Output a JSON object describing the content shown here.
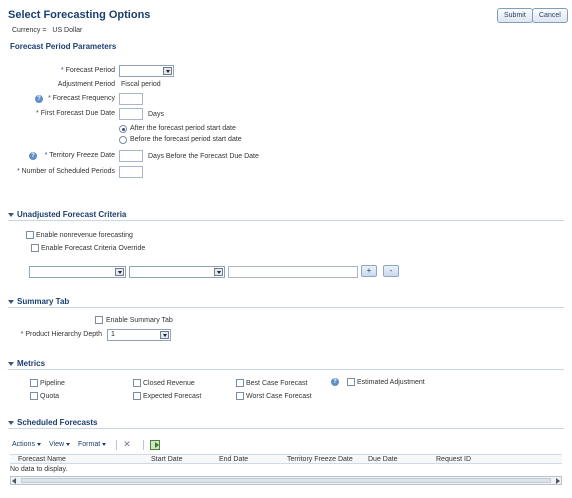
{
  "page": {
    "title": "Select Forecasting Options",
    "currency_label": "Currency =",
    "currency_value": "US Dollar",
    "submit_label": "Submit",
    "cancel_label": "Cancel"
  },
  "forecast_period_parameters": {
    "title": "Forecast Period Parameters",
    "forecast_period_label": "Forecast Period",
    "forecast_period_value": "",
    "adjustment_period_label": "Adjustment Period",
    "adjustment_period_value": "Fiscal period",
    "forecast_frequency_label": "Forecast Frequency",
    "forecast_frequency_value": "",
    "first_due_date_label": "First Forecast Due Date",
    "first_due_date_value": "",
    "first_due_date_suffix": "Days",
    "radio_after": "After the forecast period start date",
    "radio_before": "Before the forecast period start date",
    "radio_selected": "after",
    "territory_freeze_label": "Territory Freeze Date",
    "territory_freeze_value": "",
    "territory_freeze_suffix": "Days Before the Forecast Due Date",
    "num_scheduled_label": "Number of Scheduled Periods",
    "num_scheduled_value": ""
  },
  "unadjusted": {
    "title": "Unadjusted Forecast Criteria",
    "enable_nonrevenue": "Enable nonrevenue forecasting",
    "enable_nonrevenue_checked": false,
    "enable_override": "Enable Forecast Criteria Override",
    "enable_override_checked": false,
    "add_label": "+",
    "remove_label": "-"
  },
  "summary_tab": {
    "title": "Summary Tab",
    "enable_summary": "Enable Summary Tab",
    "enable_summary_checked": false,
    "depth_label": "Product Hierarchy Depth",
    "depth_value": "1"
  },
  "metrics": {
    "title": "Metrics",
    "pipeline": "Pipeline",
    "quota": "Quota",
    "closed_revenue": "Closed Revenue",
    "expected_forecast": "Expected Forecast",
    "best_case": "Best Case Forecast",
    "worst_case": "Worst Case Forecast",
    "estimated_adjustment": "Estimated Adjustment"
  },
  "scheduled": {
    "title": "Scheduled Forecasts",
    "actions_label": "Actions",
    "view_label": "View",
    "format_label": "Format",
    "columns": [
      "Forecast Name",
      "Start Date",
      "End Date",
      "Territory Freeze Date",
      "Due Date",
      "Request ID"
    ],
    "empty_text": "No data to display."
  },
  "icons": {
    "help": "help-icon",
    "delete": "delete-icon",
    "export": "export-to-excel-icon"
  },
  "colors": {
    "title": "#1b3f6e",
    "section_line": "#c9d5e2",
    "help": "#5e8fc8"
  }
}
